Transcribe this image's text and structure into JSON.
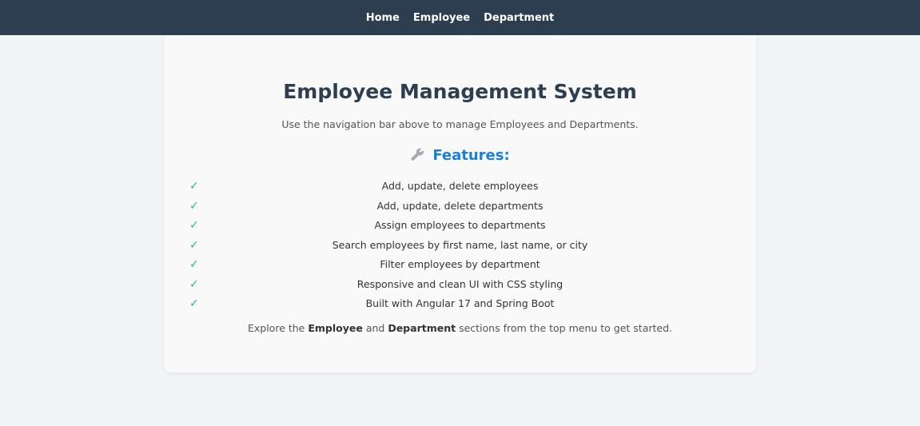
{
  "nav": {
    "items": [
      {
        "label": "Home"
      },
      {
        "label": "Employee"
      },
      {
        "label": "Department"
      }
    ]
  },
  "main": {
    "title": "Employee Management System",
    "subtitle": "Use the navigation bar above to manage Employees and Departments.",
    "features_icon": "wrench-icon",
    "features_heading": "Features:",
    "check_mark": "✓",
    "features": [
      "Add, update, delete employees",
      "Add, update, delete departments",
      "Assign employees to departments",
      "Search employees by first name, last name, or city",
      "Filter employees by department",
      "Responsive and clean UI with CSS styling",
      "Built with Angular 17 and Spring Boot"
    ],
    "footer": {
      "prefix": "Explore the ",
      "employee": "Employee",
      "and": " and ",
      "department": "Department",
      "suffix": " sections from the top menu to get started."
    }
  },
  "colors": {
    "navbar": "#2c3e50",
    "title": "#2c3e50",
    "features_heading": "#1a7fd6",
    "check": "#1abc9c",
    "background": "#f2f5f8"
  }
}
